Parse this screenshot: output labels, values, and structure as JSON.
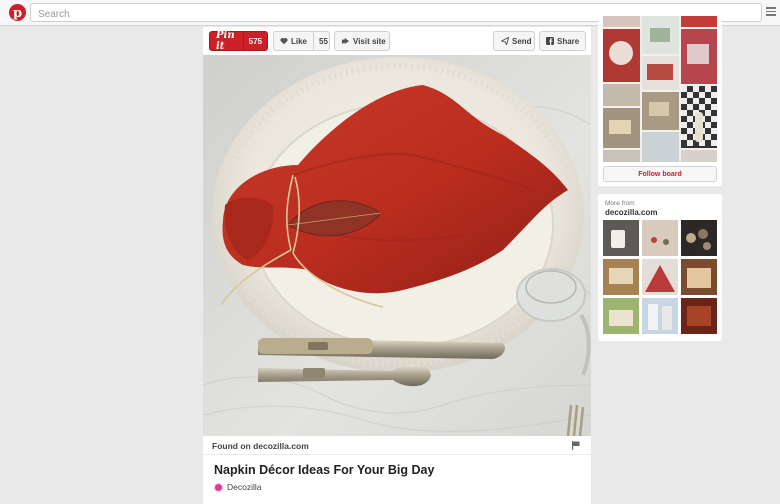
{
  "search": {
    "placeholder": "Search"
  },
  "toolbar": {
    "pinit_label": "Pin it",
    "pinit_count": "575",
    "like_label": "Like",
    "like_count": "55",
    "visit_label": "Visit site",
    "send_label": "Send",
    "share_label": "Share"
  },
  "pin": {
    "found_on": "Found on decozilla.com",
    "title": "Napkin Décor Ideas For Your Big Day",
    "source_name": "Decozilla"
  },
  "board": {
    "follow_label": "Follow board"
  },
  "more": {
    "label": "More from",
    "source": "decozilla.com"
  },
  "colors": {
    "brand_red": "#cb2027",
    "background": "#e9e9e9"
  },
  "icons": [
    "pinterest-logo-icon",
    "menu-icon",
    "heart-icon",
    "visit-site-icon",
    "send-icon",
    "share-icon",
    "flag-icon"
  ]
}
